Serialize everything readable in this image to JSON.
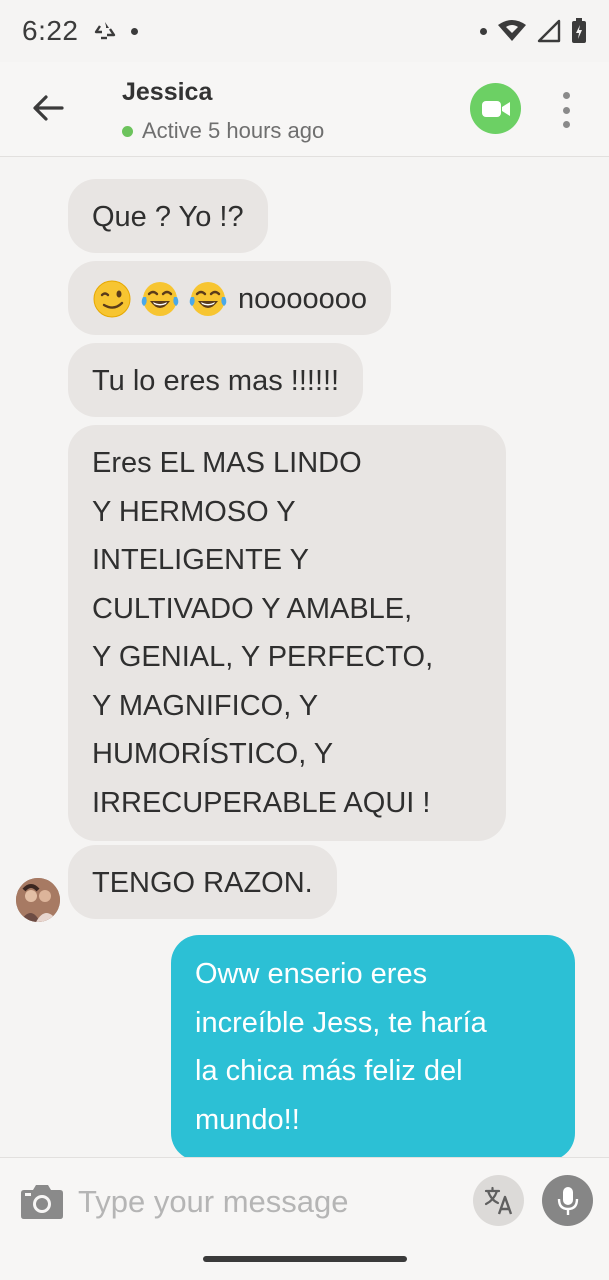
{
  "status_bar": {
    "time": "6:22"
  },
  "header": {
    "contact_name": "Jessica",
    "presence": "Active 5 hours ago",
    "icons": {
      "back": "back-arrow-icon",
      "video": "video-camera-icon",
      "more": "more-vert-icon"
    },
    "colors": {
      "video_button": "#6cd064",
      "presence_dot": "#6cc35c"
    }
  },
  "messages": {
    "incoming": [
      {
        "text": "Que ? Yo !?"
      },
      {
        "text": "nooooooo",
        "emojis": [
          "winking-face",
          "tears-of-joy",
          "tears-of-joy"
        ]
      },
      {
        "text": "Tu lo eres mas !!!!!!"
      },
      {
        "lines": [
          "Eres EL MAS LINDO",
          "Y HERMOSO Y",
          "INTELIGENTE Y",
          "CULTIVADO Y AMABLE,",
          "Y GENIAL, Y PERFECTO,",
          "Y MAGNIFICO, Y",
          "HUMORÍSTICO, Y",
          "IRRECUPERABLE AQUI !"
        ]
      },
      {
        "text": "TENGO RAZON."
      }
    ],
    "outgoing": [
      {
        "lines": [
          "Oww enserio eres",
          "increíble Jess, te haría",
          "la chica más feliz del",
          "mundo!!"
        ]
      }
    ],
    "colors": {
      "incoming_bubble": "#e8e5e3",
      "outgoing_bubble": "#2cc0d5"
    }
  },
  "composer": {
    "placeholder": "Type your message",
    "value": "",
    "icons": {
      "camera": "camera-icon",
      "translate": "translate-icon",
      "mic": "microphone-icon"
    }
  }
}
